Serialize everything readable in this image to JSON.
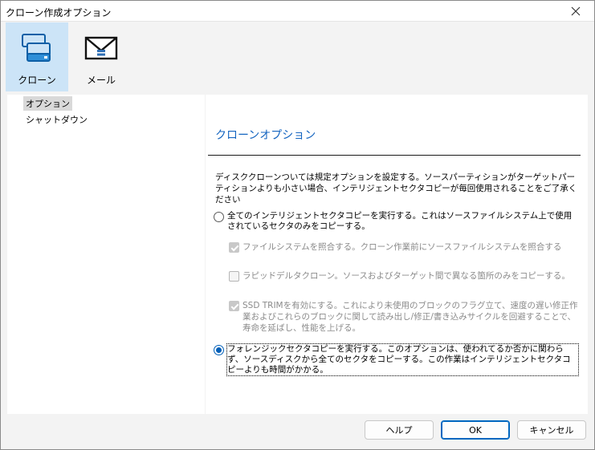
{
  "window": {
    "title": "クローン作成オプション"
  },
  "toolbar": {
    "items": [
      {
        "label": "クローン",
        "icon": "clone-drives-icon",
        "active": true
      },
      {
        "label": "メール",
        "icon": "mail-icon",
        "active": false
      }
    ]
  },
  "nav": {
    "items": [
      {
        "label": "オプション",
        "selected": true
      },
      {
        "label": "シャットダウン",
        "selected": false
      }
    ]
  },
  "section": {
    "title": "クローンオプション",
    "description": "ディスククローンついては規定オプションを設定する。ソースパーティションがターゲットパーティションよりも小さい場合、インテリジェントセクタコピーが毎回使用されることをご了承ください"
  },
  "options": {
    "intelligent": {
      "label": "全てのインテリジェントセクタコピーを実行する。これはソースファイルシステム上で使用されているセクタのみをコピーする。",
      "selected": false
    },
    "verify_fs": {
      "label": "ファイルシステムを照合する。クローン作業前にソースファイルシステムを照合する",
      "checked": true
    },
    "rapid_delta": {
      "label": "ラピッドデルタクローン。ソースおよびターゲット間で異なる箇所のみをコピーする。",
      "checked": false
    },
    "ssd_trim": {
      "label": "SSD TRIMを有効にする。これにより未使用のブロックのフラグ立て、速度の遅い修正作業およびこれらのブロックに関して読み出し/修正/書き込みサイクルを回避することで、寿命を延ばし、性能を上げる。",
      "checked": true
    },
    "forensic": {
      "label": "フォレンジックセクタコピーを実行する。このオプションは、使われてるか否かに関わらず、ソースディスクから全てのセクタをコピーする。この作業はインテリジェントセクタコピーよりも時間がかかる。",
      "selected": true
    }
  },
  "footer": {
    "help_label": "ヘルプ",
    "ok_label": "OK",
    "cancel_label": "キャンセル"
  },
  "colors": {
    "accent": "#005fb8",
    "section_title": "#1565c0",
    "active_tool_bg": "#cce4f7"
  }
}
